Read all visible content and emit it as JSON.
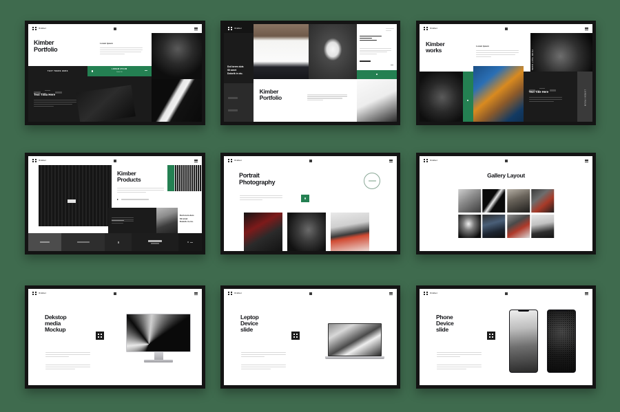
{
  "background_color": "#3f6b4e",
  "accent_green": "#248052",
  "dark": "#141414",
  "brand": "Kimber",
  "placeholder_paragraph": "Lorem ipsum dolor sit amet consectetur adipiscing elit sed do eiusmod tempor incididunt ut labore et dolore magna aliqua enim ad minim veniam.",
  "slides": [
    {
      "id": "slide-1",
      "name": "kimber-portfolio-cover",
      "topbar_style": "light",
      "brand": "Kimber",
      "title": "Kimber\nPortfolio",
      "subtitle": "Lorem Ipsum",
      "band_label": "TEXT THERE HERE",
      "cta_label": "LOREM IPSUM",
      "cta_sub": "Dolor Sit",
      "section_title": "Text Titlla Here",
      "tag_1": "LOR",
      "tag_2": "IPSU"
    },
    {
      "id": "slide-2",
      "name": "kimber-portfolio-split",
      "topbar_style": "dark",
      "brand": "Kimber",
      "sidebar_heading": "Dui lorem duis\nSit amet\nDolorik in ciu.",
      "nav_items": [
        "Text Here",
        "Text Here",
        "Text Here"
      ],
      "card_title": "Lorem ipsum\nDolor\nSit amet",
      "card_link": "LOREM IPSUM",
      "title": "Kimber\nPortfolio"
    },
    {
      "id": "slide-3",
      "name": "kimber-works",
      "topbar_style": "light",
      "brand": "Kimber",
      "title": "Kimber\nworks",
      "subtitle": "Lorem Ipsum",
      "vertical_label": "YOUR TEXT HERE",
      "vertical_label_2": "LOREM IPSUM",
      "section_title": "Text Title Here",
      "tag_1": "LOR",
      "tag_2": "IPSU"
    },
    {
      "id": "slide-4",
      "name": "kimber-products",
      "topbar_style": "light",
      "brand": "Kimber",
      "title": "Kimber\nProducts",
      "bullet_text": "Lorem ipsum dolor sit amet",
      "card_title": "Lorem ipsum",
      "side_heading": "Dui lorem duis\nSit amet\nDolorik in ciu.",
      "footer_tabs": [
        "Dolorik",
        "Lorem ipsum",
        "",
        "LOREM IPSUM"
      ],
      "footer_cta_sub": "Dolor Here"
    },
    {
      "id": "slide-5",
      "name": "portrait-photography",
      "topbar_style": "light",
      "brand": "Kimber",
      "title": "Portrait\nPhotography",
      "circle_label": "LOREM IPSUM"
    },
    {
      "id": "slide-6",
      "name": "gallery-layout",
      "topbar_style": "light",
      "brand": "Kimber",
      "title": "Gallery Layout",
      "tile_count": 8
    },
    {
      "id": "slide-7",
      "name": "desktop-media-mockup",
      "topbar_style": "light",
      "brand": "Kimber",
      "title": "Dekstop\nmedia\nMockup"
    },
    {
      "id": "slide-8",
      "name": "laptop-device-slide",
      "topbar_style": "light",
      "brand": "Kimber",
      "title": "Leptop\nDevice\nslide"
    },
    {
      "id": "slide-9",
      "name": "phone-device-slide",
      "topbar_style": "light",
      "brand": "Kimber",
      "title": "Phone\nDevice\nslide"
    }
  ]
}
